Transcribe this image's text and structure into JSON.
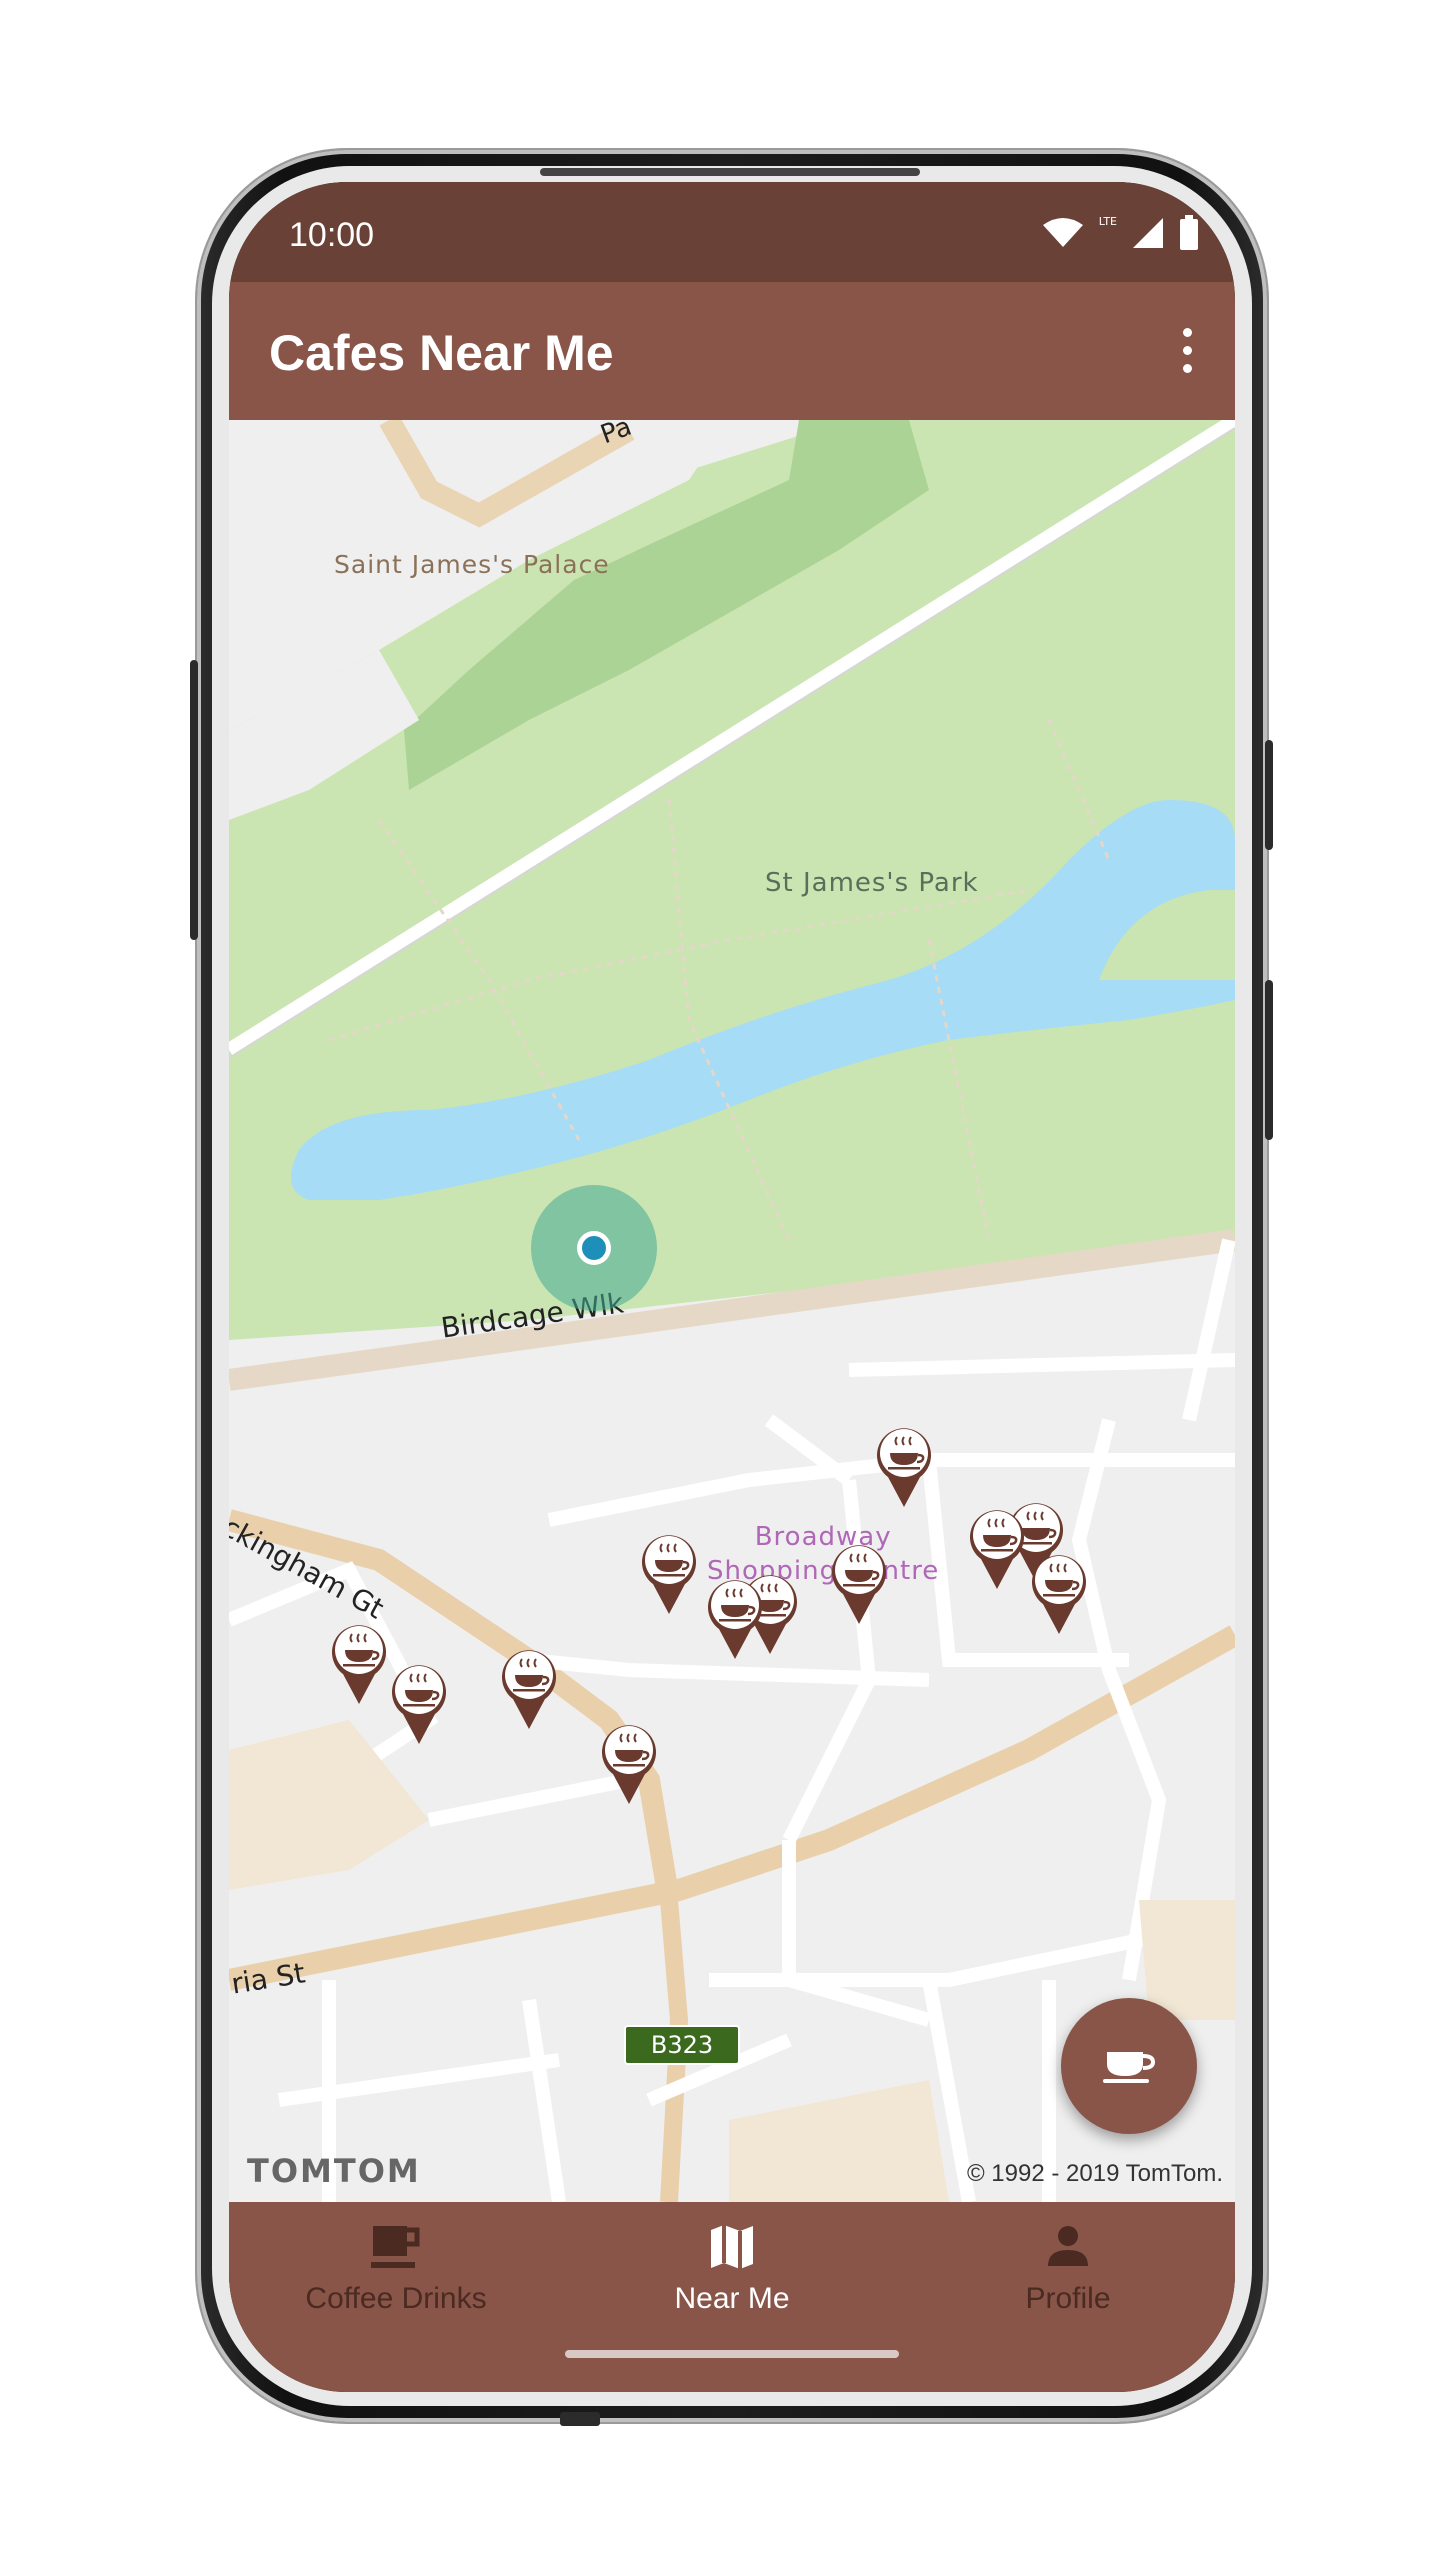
{
  "status_bar": {
    "time": "10:00",
    "network_label": "LTE"
  },
  "app_bar": {
    "title": "Cafes Near Me",
    "overflow_icon": "more-vert-icon"
  },
  "map": {
    "labels": {
      "palace": "Saint James's Palace",
      "park": "St James's Park",
      "birdcage": "Birdcage Wlk",
      "broadway_line1": "Broadway",
      "broadway_line2": "Shopping Centre",
      "buckingham": "ckingham Gt",
      "victoria": "ria St",
      "top_road": "Pa"
    },
    "road_shield": "B323",
    "provider_logo": "TOMTOM",
    "copyright": "© 1992 - 2019 TomTom.",
    "cafe_pin_icon": "coffee-cup-icon",
    "cafe_pin_count": 12
  },
  "fab": {
    "icon": "coffee-cup-icon"
  },
  "bottom_nav": {
    "items": [
      {
        "label": "Coffee Drinks",
        "icon": "coffee-mug-icon",
        "active": false
      },
      {
        "label": "Near Me",
        "icon": "map-icon",
        "active": true
      },
      {
        "label": "Profile",
        "icon": "person-icon",
        "active": false
      }
    ]
  },
  "colors": {
    "status_bar": "#6a4136",
    "primary": "#885548",
    "pin": "#6b3a2e",
    "park": "#cae5b2",
    "water": "#a6dcf5"
  }
}
